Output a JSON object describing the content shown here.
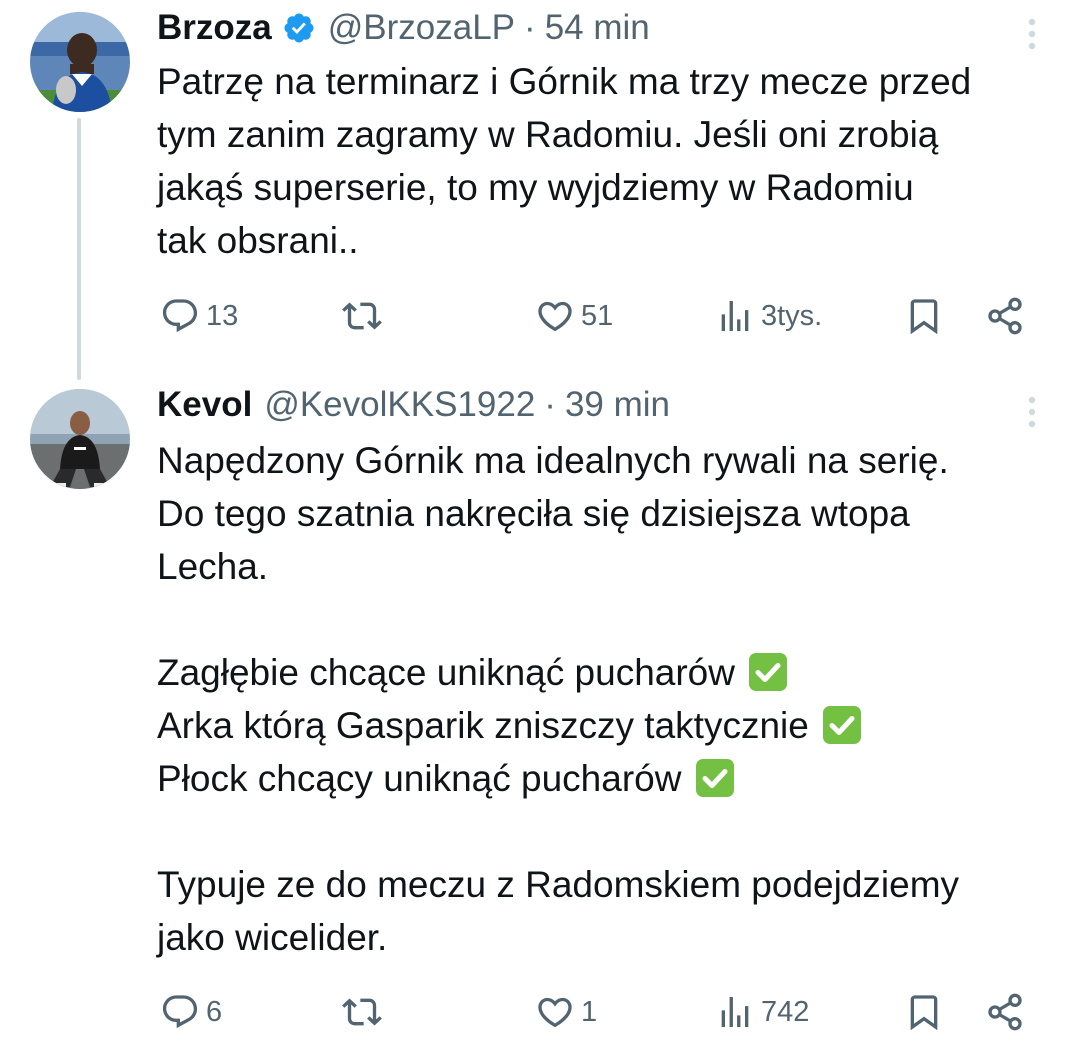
{
  "tweets": [
    {
      "display_name": "Brzoza",
      "verified": true,
      "handle": "@BrzozaLP",
      "separator": "·",
      "time": "54 min",
      "text_lines": [
        "Patrzę na terminarz i Górnik ma trzy mecze przed",
        "tym zanim zagramy w Radomiu. Jeśli oni zrobią",
        "jakąś superserie, to my wyjdziemy w Radomiu",
        "tak obsrani.."
      ],
      "stats": {
        "replies": "13",
        "retweets": "",
        "likes": "51",
        "views": "3tys."
      }
    },
    {
      "display_name": "Kevol",
      "verified": false,
      "handle": "@KevolKKS1922",
      "separator": "·",
      "time": "39 min",
      "text_lines": [
        "Napędzony Górnik ma idealnych rywali na serię.",
        "Do tego szatnia nakręciła się dzisiejsza wtopa",
        "Lecha.",
        "",
        "Zagłębie chcące uniknąć pucharów",
        "Arka którą Gasparik zniszczy taktycznie",
        "Płock chcący uniknąć pucharów",
        "",
        "Typuje ze do meczu z Radomskiem podejdziemy",
        "jako wicelider."
      ],
      "stats": {
        "replies": "6",
        "retweets": "",
        "likes": "1",
        "views": "742"
      }
    }
  ],
  "icons": {
    "reply": "reply-icon",
    "retweet": "retweet-icon",
    "like": "heart-icon",
    "views": "views-icon",
    "bookmark": "bookmark-icon",
    "share": "share-icon",
    "more": "more-vertical-icon",
    "verified": "verified-badge-icon",
    "check": "check-mark-emoji"
  },
  "colors": {
    "text": "#0f1419",
    "secondary": "#536471",
    "verified": "#1d9bf0",
    "thread_line": "#cfd9de",
    "check_emoji": "#74c043"
  }
}
